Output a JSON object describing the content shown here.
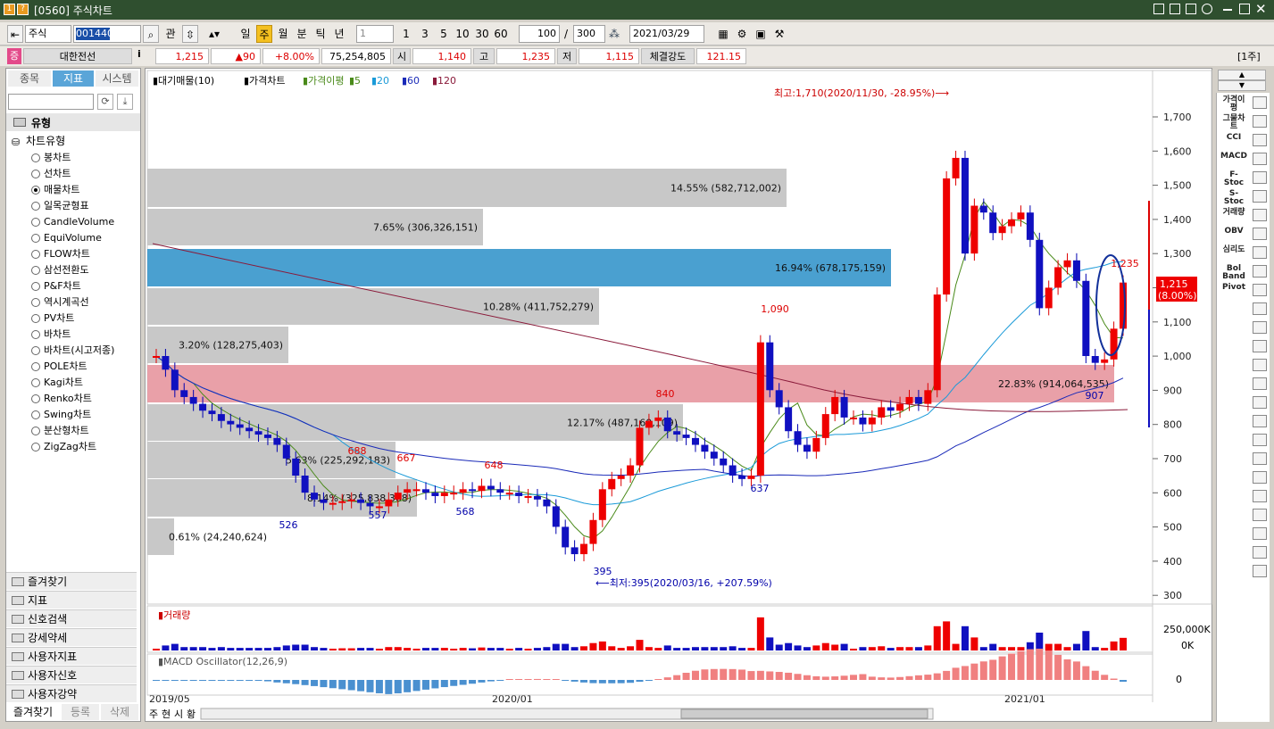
{
  "window": {
    "title": "[0560] 주식차트",
    "icons": [
      "num-icon",
      "help-icon"
    ]
  },
  "toolbar": {
    "market": "주식",
    "code": "001440",
    "kwan": "관",
    "periods": [
      "일",
      "주",
      "월",
      "분",
      "틱",
      "년"
    ],
    "selected_period": "주",
    "interval": "1",
    "quick": [
      "1",
      "3",
      "5",
      "10",
      "30",
      "60"
    ],
    "count": "100",
    "slash": "/",
    "total": "300",
    "date": "2021/03/29"
  },
  "quote": {
    "badge": "증",
    "name": "대한전선",
    "info": "i",
    "price": "1,215",
    "change": "▲90",
    "rate": "+8.00%",
    "volume": "75,254,805",
    "open_label": "시",
    "open": "1,140",
    "high_label": "고",
    "high": "1,235",
    "low_label": "저",
    "low": "1,115",
    "strength_label": "체결강도",
    "strength": "121.15",
    "unit": "[1주]"
  },
  "left": {
    "tabs": [
      "종목",
      "지표",
      "시스템"
    ],
    "active_tab": "지표",
    "section": "유형",
    "group": "차트유형",
    "types": [
      "봉차트",
      "선차트",
      "매물차트",
      "일목균형표",
      "CandleVolume",
      "EquiVolume",
      "FLOW차트",
      "삼선전환도",
      "P&F차트",
      "역시계곡선",
      "PV차트",
      "바차트",
      "바차트(시고저종)",
      "POLE차트",
      "Kagi차트",
      "Renko차트",
      "Swing차트",
      "분산형차트",
      "ZigZag차트"
    ],
    "selected_type": "매물차트",
    "folders": [
      "즐겨찾기",
      "지표",
      "신호검색",
      "강세약세",
      "사용자지표",
      "사용자신호",
      "사용자강약"
    ],
    "bottom": [
      "즐겨찾기",
      "등록",
      "삭제"
    ]
  },
  "legend": {
    "items": [
      "대기매물(10)",
      "가격차트",
      "가격이평",
      "5",
      "20",
      "60",
      "120"
    ],
    "colors": [
      "#000",
      "#000",
      "#4a8a1a",
      "#4a8a1a",
      "#1a9ad8",
      "#1a2ab8",
      "#8a1a3a"
    ]
  },
  "chart_data": {
    "type": "volume-profile-candlestick",
    "y_axis": [
      "1,700",
      "1,600",
      "1,500",
      "1,400",
      "1,300",
      "1,200",
      "1,100",
      "1,000",
      "900",
      "800",
      "700",
      "600",
      "500",
      "400",
      "300"
    ],
    "x_axis": [
      "2019/05",
      "2020/01",
      "2021/01"
    ],
    "volume_profile": [
      {
        "pct": "14.55%",
        "volume": "582,712,002"
      },
      {
        "pct": "7.65%",
        "volume": "306,326,151"
      },
      {
        "pct": "16.94%",
        "volume": "678,175,159"
      },
      {
        "pct": "10.28%",
        "volume": "411,752,279"
      },
      {
        "pct": "3.20%",
        "volume": "128,275,403"
      },
      {
        "pct": "22.83%",
        "volume": "914,064,535"
      },
      {
        "pct": "12.17%",
        "volume": "487,160,109"
      },
      {
        "pct": "5.63%",
        "volume": "225,292,183"
      },
      {
        "pct": "8.14%",
        "volume": "325,838,368"
      },
      {
        "pct": "0.61%",
        "volume": "24,240,624"
      }
    ],
    "peak_labels": [
      "1,090",
      "840",
      "688",
      "667",
      "648",
      "526",
      "557",
      "568",
      "637",
      "395",
      "907",
      "1,235"
    ],
    "max_note": "최고:1,710(2020/11/30, -28.95%)⟶",
    "min_note": "⟵최저:395(2020/03/16, +207.59%)",
    "current_price": "1,215",
    "current_rate": "(8.00%)",
    "volume_panel": {
      "title": "거래량",
      "ticks": [
        "250,000K",
        "0K"
      ]
    },
    "macd_panel": {
      "title": "MACD Oscillator(12,26,9)",
      "ticks": [
        "0"
      ]
    }
  },
  "bottom_tabs": [
    "주",
    "현",
    "시",
    "황"
  ],
  "right_indicators": [
    "가격이평",
    "그물차트",
    "CCI",
    "MACD",
    "F-Stoc",
    "S-Stoc",
    "거래량",
    "OBV",
    "심리도",
    "Bol Band",
    "Pivot"
  ]
}
